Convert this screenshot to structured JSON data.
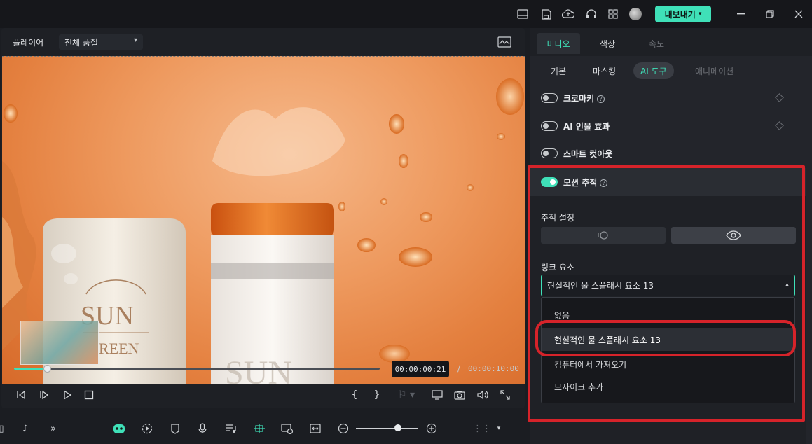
{
  "titlebar": {
    "export_label": "내보내기",
    "icons": [
      "layout-icon",
      "save-icon",
      "cloud-upload-icon",
      "headset-icon",
      "grid-icon",
      "avatar"
    ],
    "window_buttons": [
      "minimize-icon",
      "restore-icon",
      "close-icon"
    ]
  },
  "player": {
    "label": "플레이어",
    "quality": "전체 품질",
    "current_time": "00:00:00:21",
    "time_separator": "/",
    "total_time": "00:00:10:00",
    "progress": 0.09
  },
  "right_panel": {
    "tabs": [
      {
        "label": "비디오",
        "state": "active"
      },
      {
        "label": "색상",
        "state": "normal"
      },
      {
        "label": "속도",
        "state": "disabled"
      }
    ],
    "subtabs": [
      {
        "label": "기본",
        "state": "normal"
      },
      {
        "label": "마스킹",
        "state": "normal"
      },
      {
        "label": "AI 도구",
        "state": "active"
      },
      {
        "label": "애니메이션",
        "state": "disabled"
      }
    ],
    "features": [
      {
        "label": "크로마키",
        "on": false,
        "help": true
      },
      {
        "label": "AI 인물 효과",
        "on": false,
        "help": false
      },
      {
        "label": "스마트 컷아웃",
        "on": false,
        "help": false
      },
      {
        "label": "모션 추적",
        "on": true,
        "help": true
      }
    ],
    "tracking_settings_label": "추적 설정",
    "link_element_label": "링크 요소",
    "selected_element": "현실적인 물 스플래시 요소 13",
    "options": [
      "없음",
      "현실적인 물 스플래시 요소 13",
      "컴퓨터에서 가져오기",
      "모자이크 추가"
    ],
    "selected_option_index": 1
  },
  "colors": {
    "accent": "#3fe0b8",
    "annotation_red": "#d6232a",
    "panel_bg": "#23252b"
  }
}
